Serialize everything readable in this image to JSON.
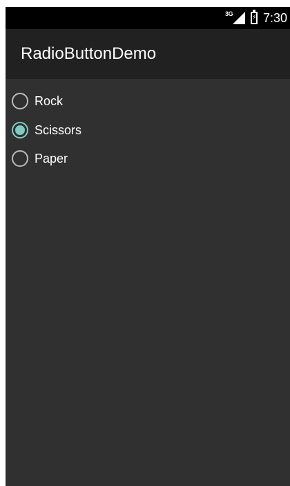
{
  "status_bar": {
    "network_type": "3G",
    "time": "7:30"
  },
  "app_bar": {
    "title": "RadioButtonDemo"
  },
  "radio_group": {
    "options": [
      {
        "label": "Rock",
        "checked": false
      },
      {
        "label": "Scissors",
        "checked": true
      },
      {
        "label": "Paper",
        "checked": false
      }
    ],
    "accent_color": "#80cbc4"
  },
  "colors": {
    "status_bar_bg": "#000000",
    "app_bar_bg": "#212121",
    "content_bg": "#303030"
  }
}
